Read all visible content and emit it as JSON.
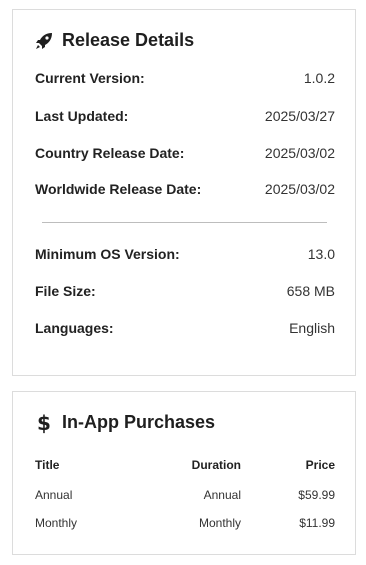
{
  "release": {
    "title": "Release Details",
    "icon": "rocket-icon",
    "rows_top": [
      {
        "label": "Current Version:",
        "value": "1.0.2"
      },
      {
        "label": "Last Updated:",
        "value": "2025/03/27"
      },
      {
        "label": "Country Release Date:",
        "value": "2025/03/02"
      },
      {
        "label": "Worldwide Release Date:",
        "value": "2025/03/02"
      }
    ],
    "rows_bottom": [
      {
        "label": "Minimum OS Version:",
        "value": "13.0"
      },
      {
        "label": "File Size:",
        "value": "658 MB"
      },
      {
        "label": "Languages:",
        "value": "English"
      }
    ]
  },
  "iap": {
    "title": "In-App Purchases",
    "icon": "dollar-icon",
    "dollar_glyph": "$",
    "headers": {
      "title": "Title",
      "duration": "Duration",
      "price": "Price"
    },
    "items": [
      {
        "title": "Annual",
        "duration": "Annual",
        "price": "$59.99"
      },
      {
        "title": "Monthly",
        "duration": "Monthly",
        "price": "$11.99"
      }
    ]
  }
}
